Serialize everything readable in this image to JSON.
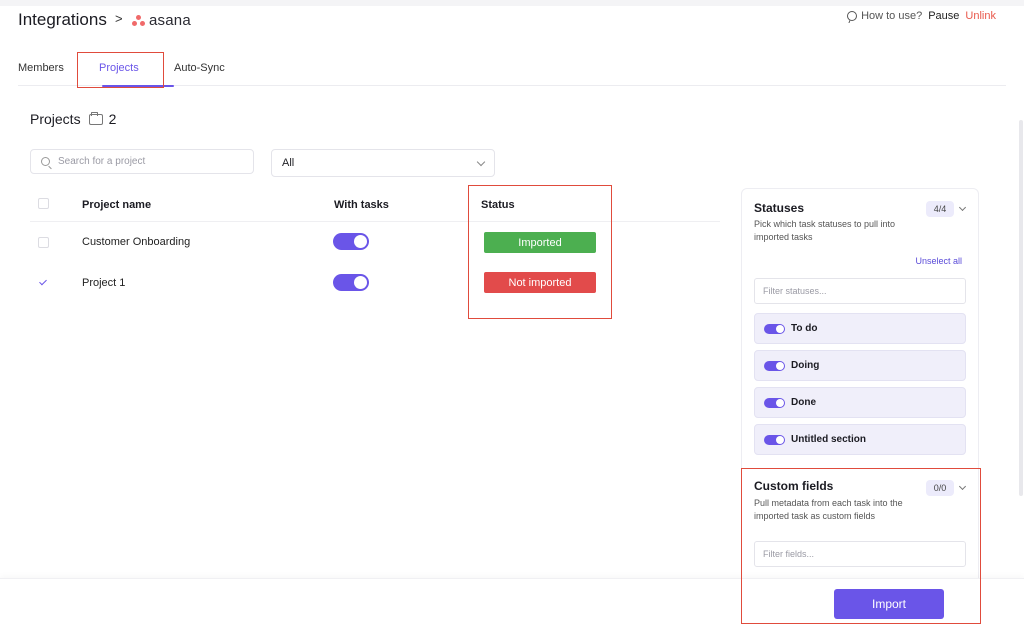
{
  "header": {
    "title": "Integrations",
    "separator": ">",
    "integration_name": "asana",
    "how_to_use": "How to use?",
    "pause": "Pause",
    "unlink": "Unlink"
  },
  "tabs": [
    {
      "label": "Members",
      "active": false
    },
    {
      "label": "Projects",
      "active": true
    },
    {
      "label": "Auto-Sync",
      "active": false
    }
  ],
  "projects": {
    "title": "Projects",
    "count": "2",
    "search_placeholder": "Search for a project",
    "filter_value": "All",
    "columns": [
      "Project name",
      "With tasks",
      "Status"
    ],
    "rows": [
      {
        "name": "Customer Onboarding",
        "checked": false,
        "with_tasks": true,
        "status": "Imported"
      },
      {
        "name": "Project 1",
        "checked": true,
        "with_tasks": true,
        "status": "Not imported"
      }
    ]
  },
  "sidebar": {
    "statuses": {
      "title": "Statuses",
      "count": "4/4",
      "description": "Pick which task statuses to pull into imported tasks",
      "unselect_all": "Unselect all",
      "filter_placeholder": "Filter statuses...",
      "items": [
        {
          "label": "To do",
          "enabled": true
        },
        {
          "label": "Doing",
          "enabled": true
        },
        {
          "label": "Done",
          "enabled": true
        },
        {
          "label": "Untitled section",
          "enabled": true
        }
      ]
    },
    "custom_fields": {
      "title": "Custom fields",
      "count": "0/0",
      "description": "Pull metadata from each task into the imported task as custom fields",
      "filter_placeholder": "Filter fields..."
    }
  },
  "footer": {
    "import_label": "Import"
  },
  "colors": {
    "accent": "#6a55e8",
    "imported": "#4caf50",
    "not_imported": "#e24b4b",
    "unlink": "#e9584b",
    "brand_asana": "#f06a6a"
  }
}
